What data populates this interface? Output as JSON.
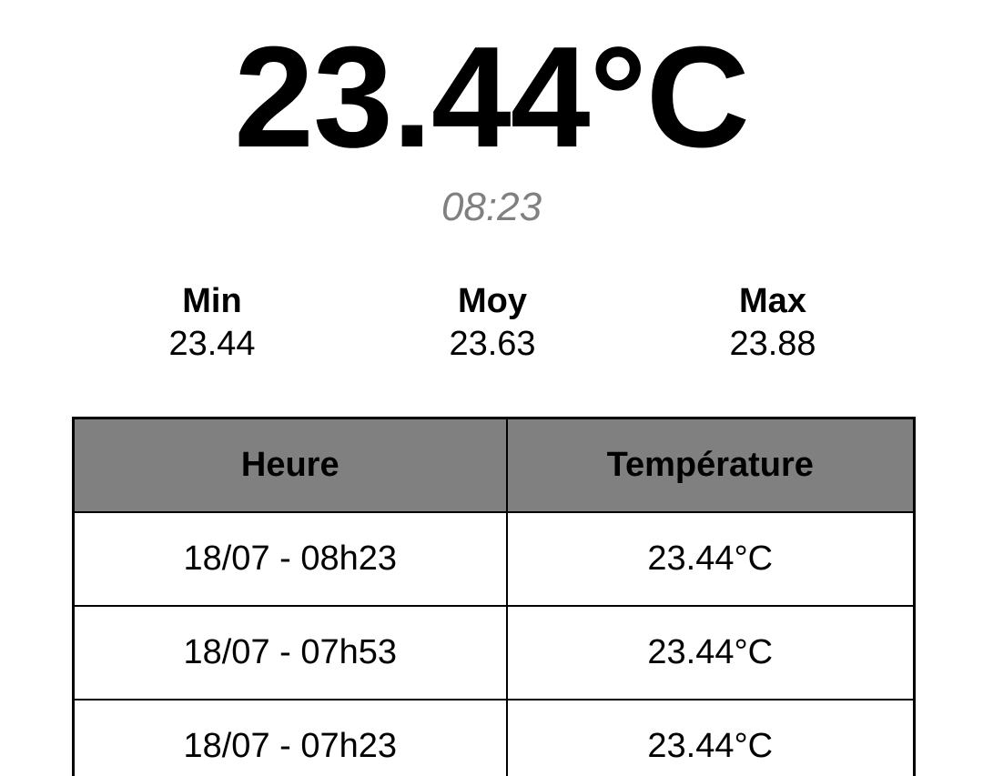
{
  "current": {
    "temperature": "23.44°C",
    "time": "08:23"
  },
  "stats": {
    "min": {
      "label": "Min",
      "value": "23.44"
    },
    "avg": {
      "label": "Moy",
      "value": "23.63"
    },
    "max": {
      "label": "Max",
      "value": "23.88"
    }
  },
  "table": {
    "headers": [
      "Heure",
      "Température"
    ],
    "rows": [
      [
        "18/07 - 08h23",
        "23.44°C"
      ],
      [
        "18/07 - 07h53",
        "23.44°C"
      ],
      [
        "18/07 - 07h23",
        "23.44°C"
      ]
    ]
  },
  "colors": {
    "header_bg": "#808080",
    "time_text": "#808080"
  }
}
